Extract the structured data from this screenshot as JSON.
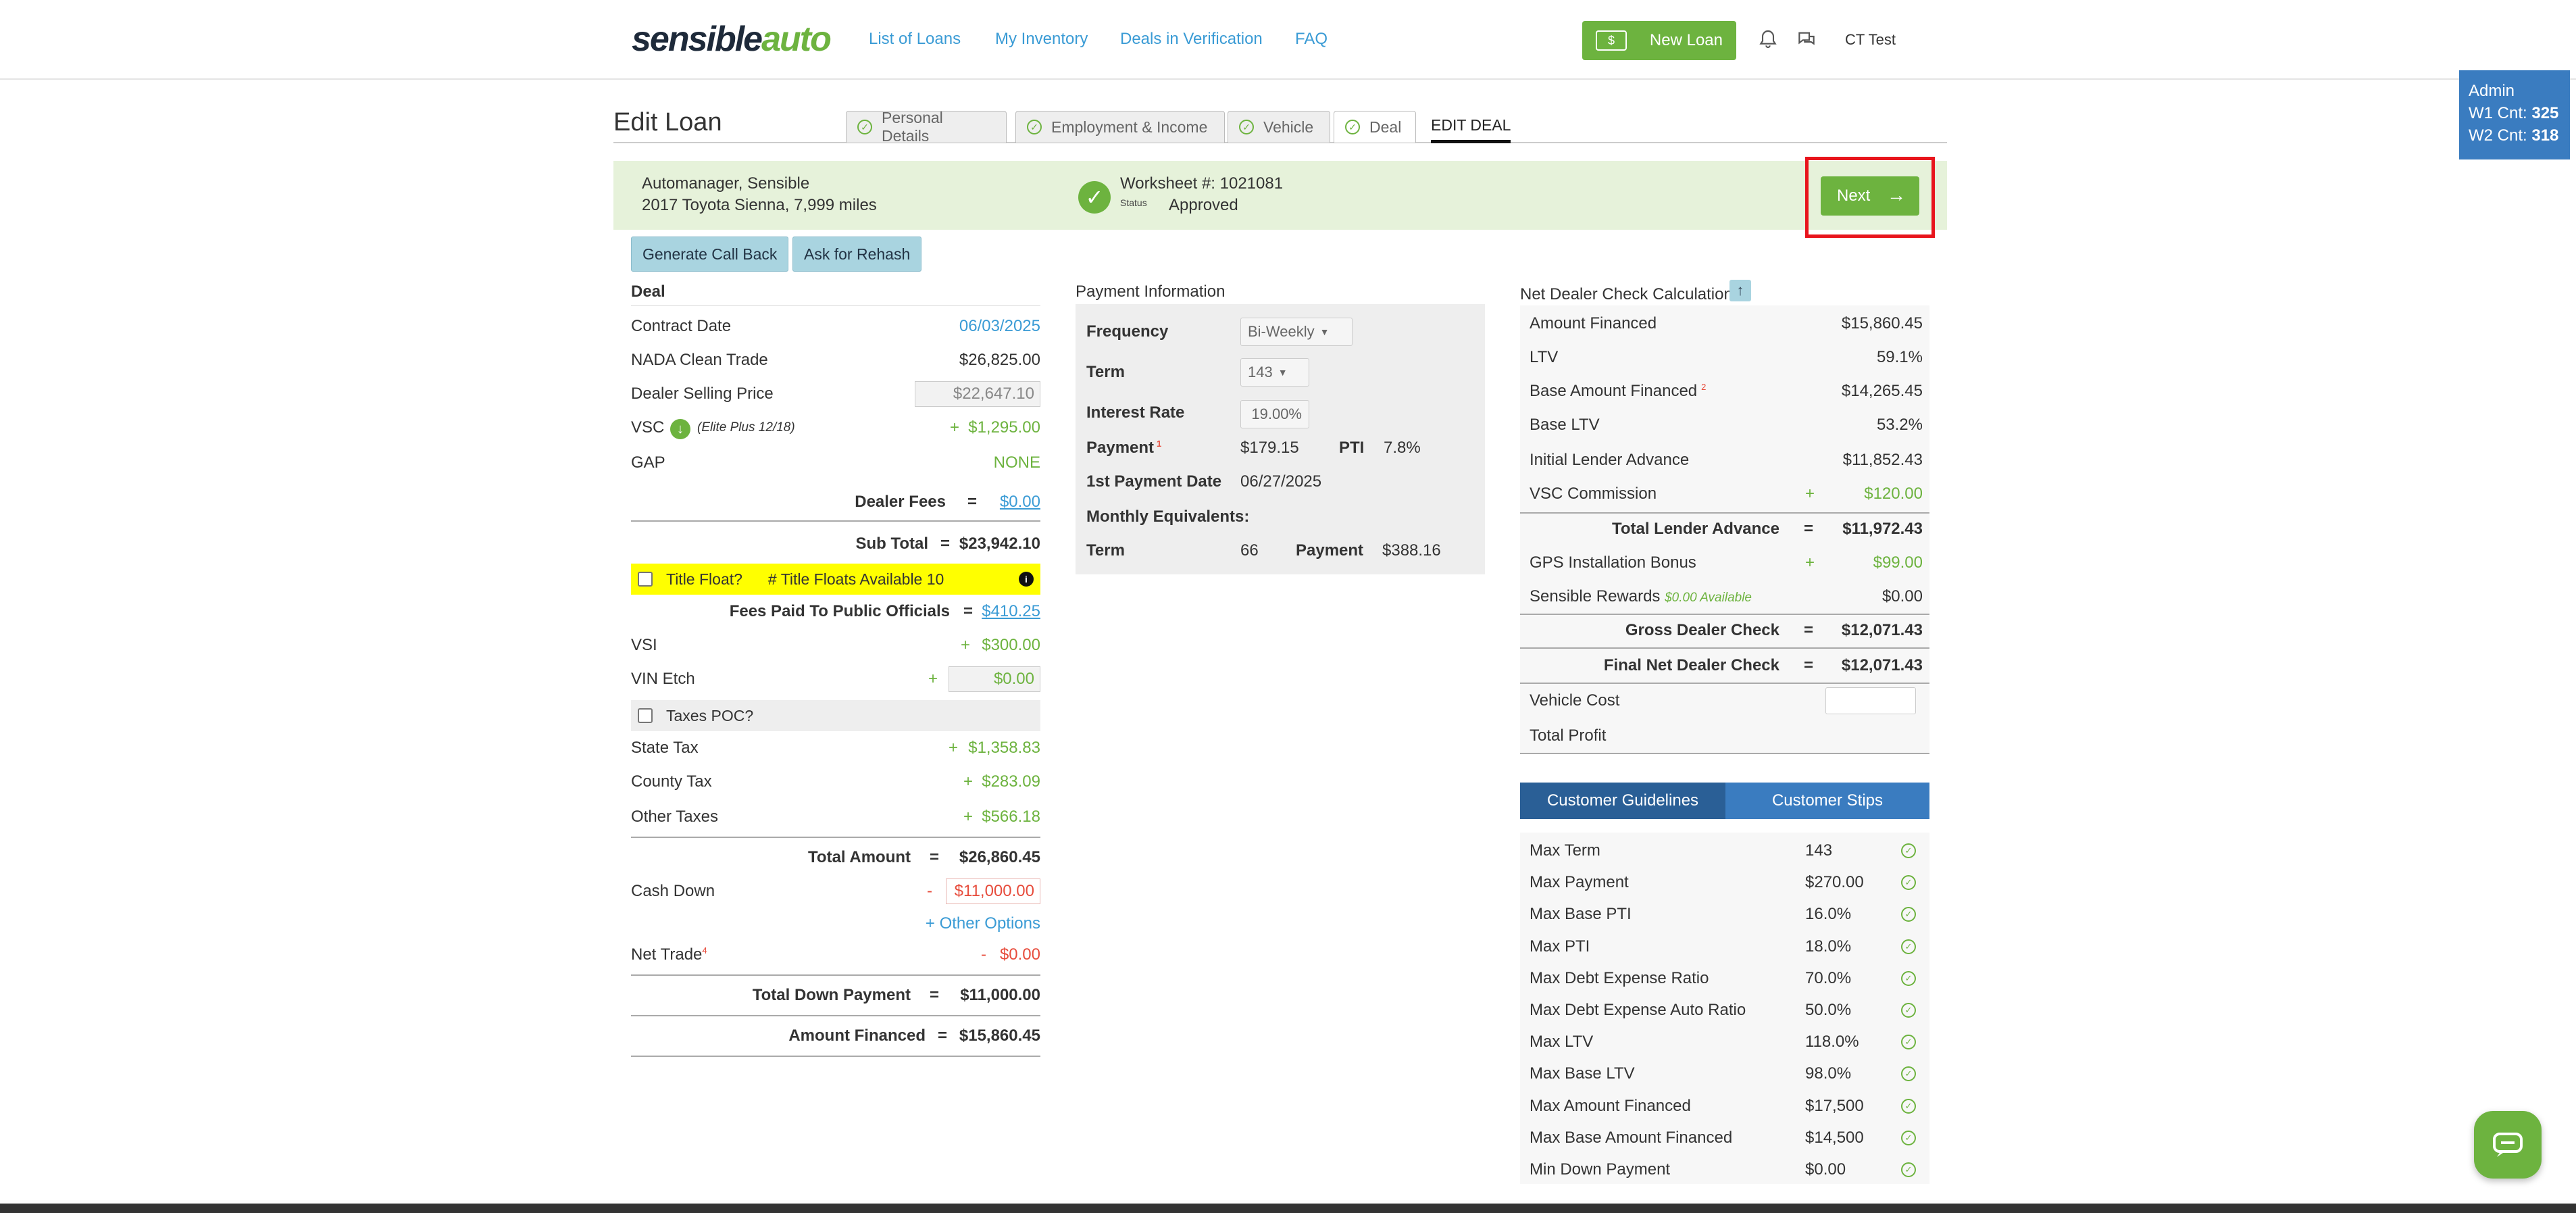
{
  "header": {
    "logo_main": "sensible",
    "logo_accent": "auto",
    "nav": [
      "List of Loans",
      "My Inventory",
      "Deals in Verification",
      "FAQ"
    ],
    "new_loan": "New Loan",
    "user": "CT Test"
  },
  "admin": {
    "role": "Admin",
    "w1_label": "W1 Cnt:",
    "w1_value": "325",
    "w2_label": "W2 Cnt:",
    "w2_value": "318"
  },
  "page": {
    "title": "Edit Loan",
    "tabs": [
      "Personal Details",
      "Employment & Income",
      "Vehicle",
      "Deal"
    ],
    "edit_tab": "EDIT DEAL"
  },
  "banner": {
    "name": "Automanager, Sensible",
    "vehicle": "2017 Toyota Sienna, 7,999 miles",
    "worksheet": "Worksheet #: 1021081",
    "status_label": "Status",
    "status_value": "Approved",
    "next": "Next"
  },
  "actions": {
    "callback": "Generate Call Back",
    "rehash": "Ask for Rehash"
  },
  "deal": {
    "title": "Deal",
    "contract_date_label": "Contract Date",
    "contract_date": "06/03/2025",
    "nada_label": "NADA Clean Trade",
    "nada": "$26,825.00",
    "dsp_label": "Dealer Selling Price",
    "dsp": "$22,647.10",
    "vsc_label": "VSC",
    "vsc_note": "(Elite Plus 12/18)",
    "vsc_sign": "+",
    "vsc": "$1,295.00",
    "gap_label": "GAP",
    "gap": "NONE",
    "dealer_fees_label": "Dealer Fees",
    "eq": "=",
    "dealer_fees": "$0.00",
    "subtotal_label": "Sub Total",
    "subtotal": "$23,942.10",
    "title_float": "Title Float?",
    "title_floats_avail": "# Title Floats Available 10",
    "fees_public_label": "Fees Paid To Public Officials",
    "fees_public": "$410.25",
    "vsi_label": "VSI",
    "vsi": "$300.00",
    "vin_label": "VIN Etch",
    "vin": "$0.00",
    "taxes_poc": "Taxes POC?",
    "state_tax_label": "State Tax",
    "state_tax": "$1,358.83",
    "county_tax_label": "County Tax",
    "county_tax": "$283.09",
    "other_tax_label": "Other Taxes",
    "other_tax": "$566.18",
    "total_amount_label": "Total Amount",
    "total_amount": "$26,860.45",
    "cash_down_label": "Cash Down",
    "minus": "-",
    "cash_down": "$11,000.00",
    "other_options": "+ Other Options",
    "net_trade_label": "Net Trade",
    "net_trade_sup": "4",
    "net_trade": "$0.00",
    "total_down_label": "Total Down Payment",
    "total_down": "$11,000.00",
    "amount_financed_label": "Amount Financed",
    "amount_financed": "$15,860.45"
  },
  "payment": {
    "title": "Payment Information",
    "frequency_label": "Frequency",
    "frequency": "Bi-Weekly",
    "term_label": "Term",
    "term": "143",
    "rate_label": "Interest Rate",
    "rate": "19.00%",
    "payment_label": "Payment",
    "payment_sup": "1",
    "payment": "$179.15",
    "pti_label": "PTI",
    "pti": "7.8%",
    "first_date_label": "1st Payment Date",
    "first_date": "06/27/2025",
    "monthly_label": "Monthly Equivalents:",
    "m_term_label": "Term",
    "m_term": "66",
    "m_payment_label": "Payment",
    "m_payment": "$388.16"
  },
  "net": {
    "title": "Net Dealer Check Calculation",
    "rows": [
      {
        "label": "Amount Financed",
        "sign": "",
        "value": "$15,860.45"
      },
      {
        "label": "LTV",
        "sign": "",
        "value": "59.1%"
      },
      {
        "label": "Base Amount Financed",
        "sign": "",
        "value": "$14,265.45"
      },
      {
        "label": "Base LTV",
        "sign": "",
        "value": "53.2%"
      },
      {
        "label": "Initial Lender Advance",
        "sign": "",
        "value": "$11,852.43"
      },
      {
        "label": "VSC Commission",
        "sign": "+",
        "value": "$120.00"
      }
    ],
    "base_sup": "2",
    "total_adv_label": "Total Lender Advance",
    "eq": "=",
    "total_adv": "$11,972.43",
    "gps_label": "GPS Installation Bonus",
    "plus": "+",
    "gps": "$99.00",
    "rewards_label": "Sensible Rewards",
    "rewards_avail": "$0.00 Available",
    "rewards": "$0.00",
    "gross_label": "Gross Dealer Check",
    "gross": "$12,071.43",
    "final_label": "Final Net Dealer Check",
    "final": "$12,071.43",
    "vehicle_cost_label": "Vehicle Cost",
    "total_profit_label": "Total Profit"
  },
  "guidelines": {
    "tab1": "Customer Guidelines",
    "tab2": "Customer Stips",
    "rows": [
      {
        "label": "Max Term",
        "value": "143"
      },
      {
        "label": "Max Payment",
        "value": "$270.00"
      },
      {
        "label": "Max Base PTI",
        "value": "16.0%"
      },
      {
        "label": "Max PTI",
        "value": "18.0%"
      },
      {
        "label": "Max Debt Expense Ratio",
        "value": "70.0%"
      },
      {
        "label": "Max Debt Expense Auto Ratio",
        "value": "50.0%"
      },
      {
        "label": "Max LTV",
        "value": "118.0%"
      },
      {
        "label": "Max Base LTV",
        "value": "98.0%"
      },
      {
        "label": "Max Amount Financed",
        "value": "$17,500"
      },
      {
        "label": "Max Base Amount Financed",
        "value": "$14,500"
      },
      {
        "label": "Min Down Payment",
        "value": "$0.00"
      }
    ]
  },
  "colors": {
    "brand_green": "#6db33f",
    "link_blue": "#3a9bd5",
    "highlight_red": "#e8141c",
    "tab_blue": "#2a6aae"
  }
}
